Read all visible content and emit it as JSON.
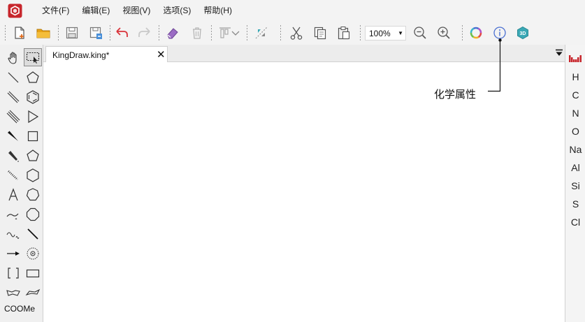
{
  "menubar": {
    "items": [
      "文件(F)",
      "编辑(E)",
      "视图(V)",
      "选项(S)",
      "帮助(H)"
    ]
  },
  "toolbar": {
    "zoom": "100%",
    "icons": [
      "new-file-icon",
      "open-folder-icon",
      "save-icon",
      "save-as-icon",
      "undo-icon",
      "redo-icon",
      "eraser-icon",
      "delete-icon",
      "align-icon",
      "flip-icon",
      "cut-icon",
      "copy-icon",
      "paste-icon",
      "zoom-out-icon",
      "zoom-in-icon",
      "color-wheel-icon",
      "info-icon",
      "3d-icon"
    ]
  },
  "document": {
    "tab_title": "KingDraw.king*",
    "close_glyph": "✕"
  },
  "palette": {
    "coome_label": "COOMe"
  },
  "elements": [
    "H",
    "C",
    "N",
    "O",
    "Na",
    "Al",
    "Si",
    "S",
    "Cl"
  ],
  "annotation": {
    "label": "化学属性"
  },
  "colors": {
    "logo_red": "#c7262c",
    "folder_yellow": "#e8a317",
    "undo_red": "#d9343b",
    "eraser_purple": "#9b6cc4",
    "info_blue": "#4a6fd1",
    "threed_teal": "#3aa8b5"
  }
}
